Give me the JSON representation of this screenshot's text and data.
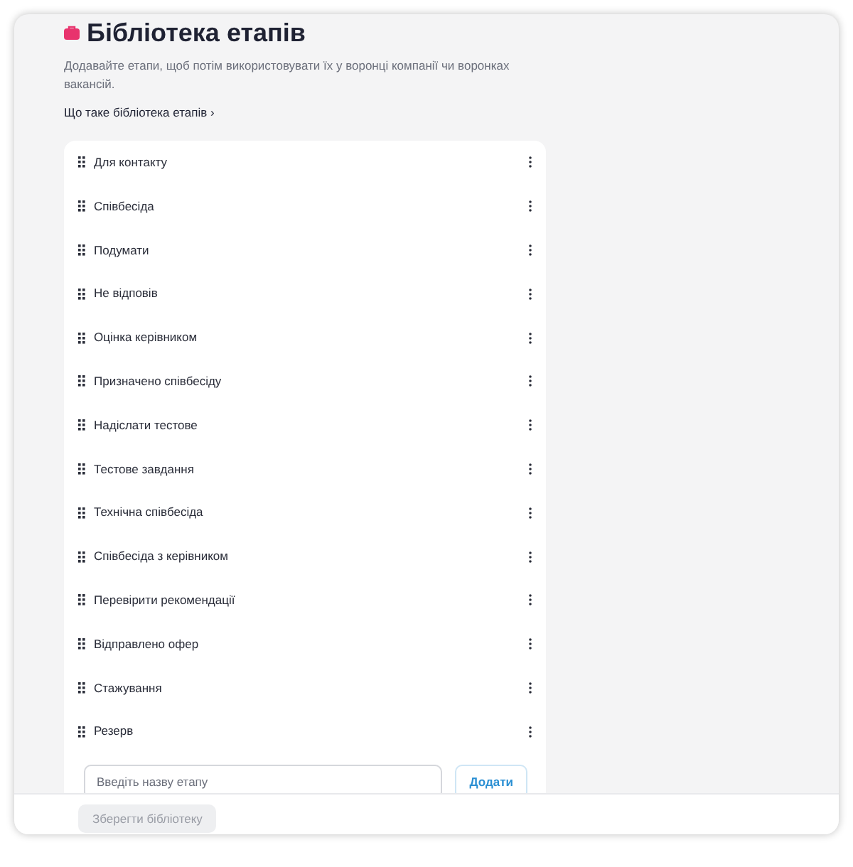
{
  "title": "Бібліотека етапів",
  "description": "Додавайте етапи, щоб потім використовувати їх у воронці компанії чи воронках вакансій.",
  "help_link": "Що таке бібліотека етапів ›",
  "stages": [
    {
      "name": "Для контакту"
    },
    {
      "name": "Співбесіда"
    },
    {
      "name": "Подумати"
    },
    {
      "name": "Не відповів"
    },
    {
      "name": "Оцінка керівником"
    },
    {
      "name": "Призначено співбесіду"
    },
    {
      "name": "Надіслати тестове"
    },
    {
      "name": "Тестове завдання"
    },
    {
      "name": "Технічна співбесіда"
    },
    {
      "name": "Співбесіда з керівником"
    },
    {
      "name": "Перевірити рекомендації"
    },
    {
      "name": "Відправлено офер"
    },
    {
      "name": "Стажування"
    },
    {
      "name": "Резерв"
    }
  ],
  "new_stage": {
    "placeholder": "Введіть назву етапу"
  },
  "add_button": "Додати",
  "save_button": {
    "label": "Зберегти бібліотеку",
    "disabled": true
  }
}
